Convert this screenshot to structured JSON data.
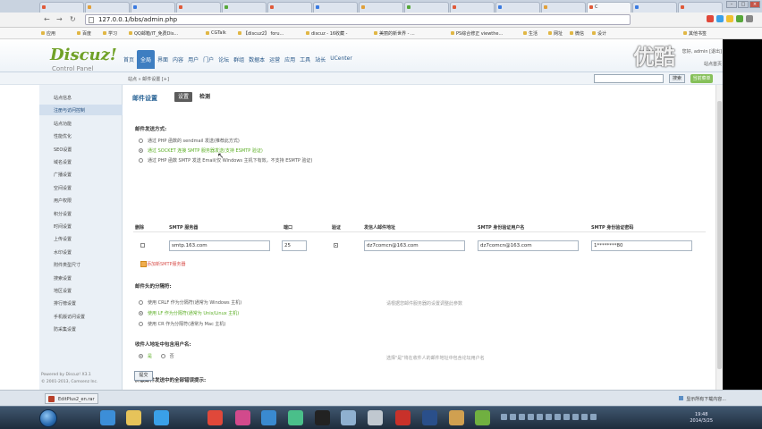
{
  "browser": {
    "tabs": [
      {
        "label": "",
        "color": "#e05a3a"
      },
      {
        "label": "",
        "color": "#e0a03a"
      },
      {
        "label": "",
        "color": "#3a7ae0"
      },
      {
        "label": "",
        "color": "#e05a3a"
      },
      {
        "label": "",
        "color": "#57a83a"
      },
      {
        "label": "",
        "color": "#e05a3a"
      },
      {
        "label": "",
        "color": "#3a7ae0"
      },
      {
        "label": "",
        "color": "#e0a03a"
      },
      {
        "label": "",
        "color": "#57a83a"
      },
      {
        "label": "",
        "color": "#e05a3a"
      },
      {
        "label": "",
        "color": "#3a7ae0"
      },
      {
        "label": "",
        "color": "#e0a03a"
      },
      {
        "label": "C",
        "color": "#e05a3a"
      },
      {
        "label": "",
        "color": "#3a7ae0"
      },
      {
        "label": "",
        "color": "#e05a3a"
      }
    ],
    "url": "127.0.0.1/bbs/admin.php",
    "bookmarks": [
      "应用",
      "百度",
      "学习",
      "QQ邮箱/IT_免费Dis...",
      "CGTalk",
      "【discuz2】 foru...",
      "discuz - 16收藏 -",
      "美丽的新世界 - ...",
      "PS综合修正 viewthe...",
      "生活",
      "网址",
      "微信",
      "设计",
      "其他书签"
    ]
  },
  "admin": {
    "logo": "Discuz!",
    "logo_sub": "Control Panel",
    "topnav": [
      "首页",
      "全局",
      "界面",
      "内容",
      "用户",
      "门户",
      "论坛",
      "群组",
      "数据本",
      "运营",
      "应用",
      "工具",
      "站长",
      "UCenter"
    ],
    "header_right_1": "您好, admin [退出]",
    "header_right_2": "站点首页",
    "breadcrumb": "站点 » 邮件设置 [+]",
    "search_button": "搜索",
    "green_button": "当前菜单"
  },
  "watermark": "优酷",
  "sidebar": {
    "items": [
      "站点信息",
      "注册与访问控制",
      "站点功能",
      "性能优化",
      "SEO设置",
      "域名设置",
      "广播设置",
      "空间设置",
      "用户权限",
      "积分设置",
      "时间设置",
      "上传设置",
      "水印设置",
      "附件类型尺寸",
      "搜索设置",
      "地区设置",
      "排行榜设置",
      "手机版访问设置",
      "防采集设置"
    ],
    "footer_1": "Powered by Discuz! X3.1",
    "footer_2": "© 2001-2013, Comsenz Inc."
  },
  "content": {
    "title": "邮件设置",
    "tab_settings": "设置",
    "tab_check": "检测",
    "send_section": "邮件发送方式:",
    "send_options": [
      {
        "label": "通过 PHP 函数的 sendmail 发送(推荐此方式)",
        "selected": false
      },
      {
        "label": "通过 SOCKET 连接 SMTP 服务器发送(支持 ESMTP 验证)",
        "selected": true
      },
      {
        "label": "通过 PHP 函数 SMTP 发送 Email(仅 Windows 主机下有效，不支持 ESMTP 验证)",
        "selected": false
      }
    ],
    "table_headers": [
      "删除",
      "SMTP 服务器",
      "端口",
      "验证",
      "发信人邮件地址",
      "SMTP 身份验证用户名",
      "SMTP 身份验证密码"
    ],
    "smtp_row": {
      "server": "smtp.163.com",
      "port": "25",
      "auth": true,
      "from": "dz7comcn@163.com",
      "username": "dz7comcn@163.com",
      "password": "1********80"
    },
    "add_link": "添加新SMTP服务器",
    "sep_section": "邮件头的分隔符:",
    "sep_options": [
      {
        "label": "使用 CRLF 作为分隔符(通常为 Windows 主机)",
        "selected": false
      },
      {
        "label": "使用 LF 作为分隔符(通常为 Unix/Linux 主机)",
        "selected": true
      },
      {
        "label": "使用 CR 作为分隔符(通常为 Mac 主机)",
        "selected": false
      }
    ],
    "sep_hint": "请根据您邮件服务器的设置调整此参数",
    "username_section": "收件人地址中包含用户名:",
    "username_hint": "选择\"是\"将在收件人的邮件地址中包含论坛用户名",
    "silent_section": "屏蔽邮件发送中的全部错误提示:",
    "yes": "是",
    "no": "否",
    "submit": "提交"
  },
  "downloads": {
    "file": "EditPlus2_en.rar",
    "show_all": "显示所有下载内容..."
  },
  "taskbar": {
    "icons": [
      {
        "name": "ie-icon",
        "color": "#3c8ed8"
      },
      {
        "name": "explorer-icon",
        "color": "#e6c35a"
      },
      {
        "name": "qq-browser-icon",
        "color": "#3aa0e8"
      },
      {
        "name": "chrome-icon",
        "color": "#e0483a"
      },
      {
        "name": "video-player-icon",
        "color": "#d24a8c"
      },
      {
        "name": "media-icon",
        "color": "#3a8ad0"
      },
      {
        "name": "software-icon",
        "color": "#4abf8a"
      },
      {
        "name": "qq-icon",
        "color": "#222222"
      },
      {
        "name": "folder-icon",
        "color": "#8fb0d0"
      },
      {
        "name": "network-icon",
        "color": "#c0c8d0"
      },
      {
        "name": "filezilla-icon",
        "color": "#c8312a"
      },
      {
        "name": "photoshop-icon",
        "color": "#2a4f8a"
      },
      {
        "name": "app-icon",
        "color": "#d0a050"
      },
      {
        "name": "app-icon-2",
        "color": "#70b040"
      },
      {
        "name": "app-icon-3",
        "color": "#c07050"
      }
    ],
    "time": "19:48",
    "date": "2014/3/25"
  }
}
